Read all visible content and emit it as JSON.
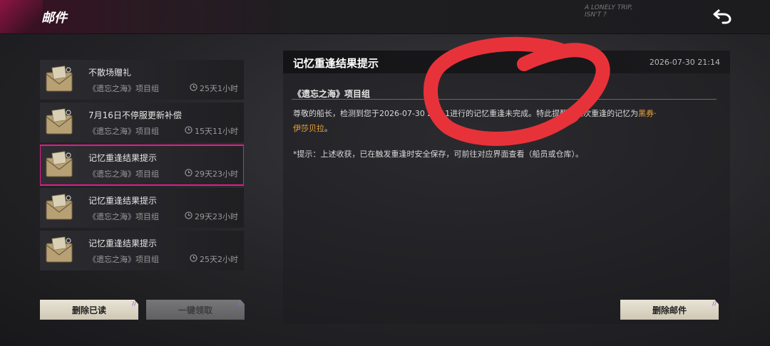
{
  "header": {
    "title": "邮件",
    "corner_scrawl_line1": "A LONELY TRIP,",
    "corner_scrawl_line2": "ISN'T ?",
    "back_icon": "back-arrow-icon"
  },
  "mail_list": [
    {
      "title": "不散场赠礼",
      "sender": "《遗忘之海》项目组",
      "time_left": "25天1小时",
      "selected": false
    },
    {
      "title": "7月16日不停服更新补偿",
      "sender": "《遗忘之海》项目组",
      "time_left": "15天11小时",
      "selected": false
    },
    {
      "title": "记忆重逢结果提示",
      "sender": "《遗忘之海》项目组",
      "time_left": "29天23小时",
      "selected": true
    },
    {
      "title": "记忆重逢结果提示",
      "sender": "《遗忘之海》项目组",
      "time_left": "29天23小时",
      "selected": false
    },
    {
      "title": "记忆重逢结果提示",
      "sender": "《遗忘之海》项目组",
      "time_left": "25天2小时",
      "selected": false
    }
  ],
  "buttons": {
    "delete_read": "删除已读",
    "claim_all": "一键领取",
    "delete_mail": "删除邮件"
  },
  "detail": {
    "title": "记忆重逢结果提示",
    "date": "2026-07-30 21:14",
    "sender": "《遗忘之海》项目组",
    "body_prefix": "尊敬的船长，检测到您于2026-07-30 21:11进行的记忆重逢未完成。特此提醒：该次重逢的记忆为",
    "body_highlight_1": "黑券·",
    "body_highlight_2": "伊莎贝拉",
    "body_suffix": "。",
    "note": "*提示：上述收获，已在触发重逢时安全保存，可前往对应界面查看（船员或仓库）。"
  },
  "colors": {
    "selection_outline": "#e6198c",
    "highlight_text": "#f0a438",
    "scribble_red": "#e8323a"
  }
}
